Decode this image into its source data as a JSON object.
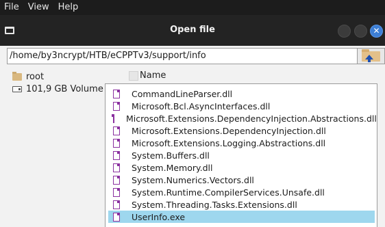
{
  "menubar": {
    "items": [
      "File",
      "View",
      "Help"
    ]
  },
  "dialog": {
    "title": "Open file",
    "path": "/home/by3ncrypt/HTB/eCPPTv3/support/info",
    "close_symbol": "✕"
  },
  "places": [
    {
      "label": "root",
      "icon": "folder-icon"
    },
    {
      "label": "101,9 GB Volume",
      "icon": "drive-icon"
    }
  ],
  "file_list": {
    "column_header": "Name",
    "selected_index": 10,
    "files": [
      "CommandLineParser.dll",
      "Microsoft.Bcl.AsyncInterfaces.dll",
      "Microsoft.Extensions.DependencyInjection.Abstractions.dll",
      "Microsoft.Extensions.DependencyInjection.dll",
      "Microsoft.Extensions.Logging.Abstractions.dll",
      "System.Buffers.dll",
      "System.Memory.dll",
      "System.Numerics.Vectors.dll",
      "System.Runtime.CompilerServices.Unsafe.dll",
      "System.Threading.Tasks.Extensions.dll",
      "UserInfo.exe"
    ]
  },
  "colors": {
    "selection": "#9ed7ee",
    "title_bar": "#232323",
    "close_button": "#3d7fd6",
    "file_icon": "#8a2f9f"
  }
}
